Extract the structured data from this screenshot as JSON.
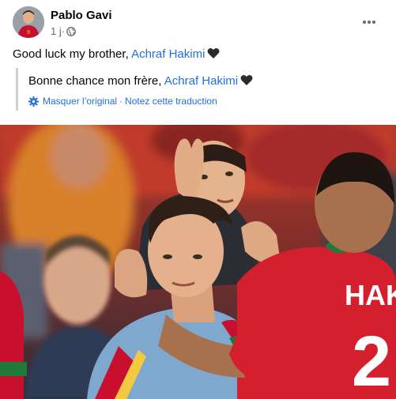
{
  "post": {
    "author": "Pablo Gavi",
    "time": "1 j",
    "time_sep": "·",
    "text": "Good luck my brother, ",
    "mention": "Achraf Hakimi",
    "heart_icon": "black-heart-icon"
  },
  "translation": {
    "text": "Bonne chance mon frère, ",
    "mention": "Achraf Hakimi",
    "hide_original": "Masquer l’original",
    "separator": "·",
    "rate": "Notez cette traduction"
  },
  "photo": {
    "jersey_text": "HAK",
    "jersey_number": "2",
    "avatar_number": "9"
  },
  "colors": {
    "link": "#216fdb",
    "spain_red": "#c8102e",
    "morocco_red": "#d4202e",
    "morocco_green": "#1f7a3a"
  }
}
